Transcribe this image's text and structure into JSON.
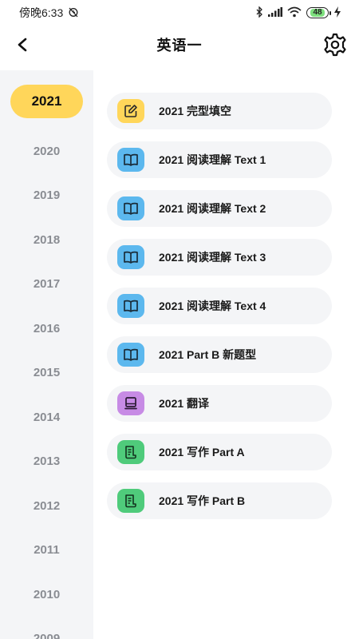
{
  "status_bar": {
    "time": "傍晚6:33",
    "battery": "48"
  },
  "header": {
    "title": "英语一"
  },
  "sidebar": {
    "years": [
      "2021",
      "2020",
      "2019",
      "2018",
      "2017",
      "2016",
      "2015",
      "2014",
      "2013",
      "2012",
      "2011",
      "2010",
      "2009"
    ],
    "active_index": 0
  },
  "list": {
    "items": [
      {
        "label": "2021 完型填空",
        "icon": "edit-icon",
        "color": "#ffd65a"
      },
      {
        "label": "2021 阅读理解 Text 1",
        "icon": "book-icon",
        "color": "#5cb8ee"
      },
      {
        "label": "2021 阅读理解 Text 2",
        "icon": "book-icon",
        "color": "#5cb8ee"
      },
      {
        "label": "2021 阅读理解 Text 3",
        "icon": "book-icon",
        "color": "#5cb8ee"
      },
      {
        "label": "2021 阅读理解 Text 4",
        "icon": "book-icon",
        "color": "#5cb8ee"
      },
      {
        "label": "2021 Part B 新题型",
        "icon": "book-icon",
        "color": "#5cb8ee"
      },
      {
        "label": "2021 翻译",
        "icon": "monitor-icon",
        "color": "#c78be5"
      },
      {
        "label": "2021 写作 Part A",
        "icon": "document-icon",
        "color": "#4fcb7b"
      },
      {
        "label": "2021 写作 Part B",
        "icon": "document-icon",
        "color": "#4fcb7b"
      }
    ]
  }
}
